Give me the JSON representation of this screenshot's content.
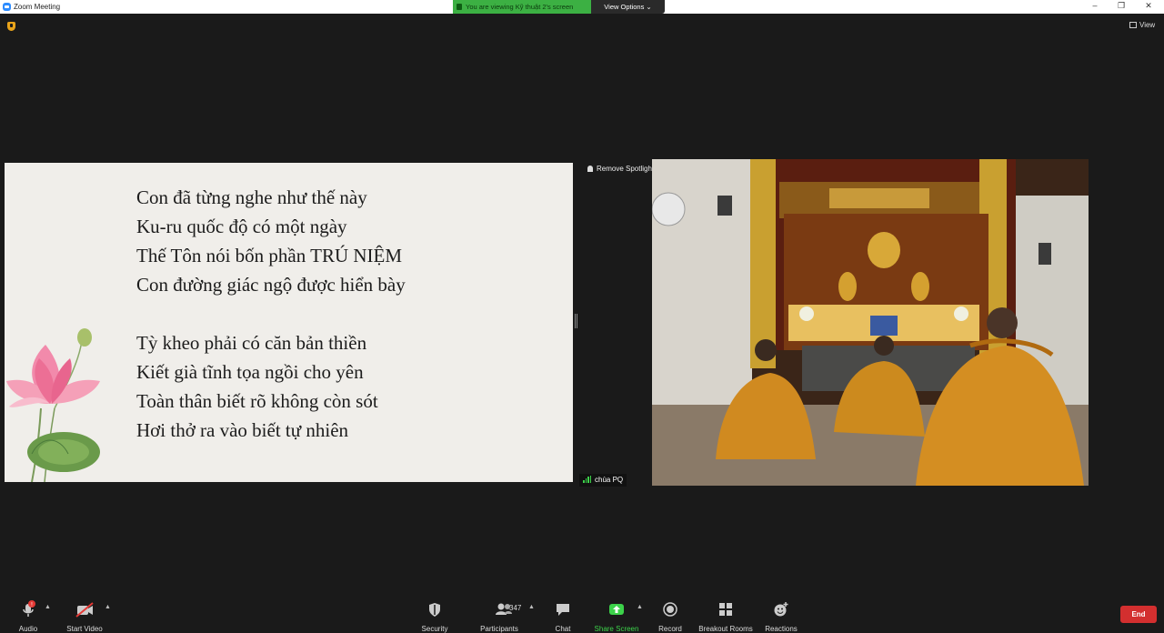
{
  "window": {
    "title": "Zoom Meeting",
    "controls": {
      "minimize": "–",
      "restore": "❐",
      "close": "✕"
    }
  },
  "banner": {
    "viewing_text": "You are viewing Kỹ thuật 2's screen",
    "view_options_label": "View Options ⌄",
    "view_button_label": "View",
    "colors": {
      "banner_green": "#3cb043"
    }
  },
  "slide": {
    "stanza1": [
      "Con đã từng nghe như thế này",
      "Ku-ru quốc độ có một ngày",
      "Thế Tôn nói bốn phần TRÚ NIỆM",
      "Con đường giác ngộ được hiển bày"
    ],
    "stanza2": [
      "Tỳ kheo phải có căn bản thiền",
      "Kiết già tĩnh tọa ngồi cho yên",
      "Toàn thân biết rõ không còn sót",
      "Hơi thở ra vào biết tự nhiên"
    ]
  },
  "video": {
    "remove_spotlight_label": "Remove Spotlight",
    "participant_name": "chùa PQ"
  },
  "toolbar": {
    "audio": {
      "label": "Audio",
      "badge": "!"
    },
    "video": {
      "label": "Start Video"
    },
    "security": {
      "label": "Security"
    },
    "participants": {
      "label": "Participants",
      "count": "347"
    },
    "chat": {
      "label": "Chat"
    },
    "share": {
      "label": "Share Screen"
    },
    "record": {
      "label": "Record"
    },
    "breakout": {
      "label": "Breakout Rooms"
    },
    "reactions": {
      "label": "Reactions"
    },
    "end": {
      "label": "End"
    },
    "colors": {
      "share_green": "#3cd24a",
      "end_red": "#d32f2f"
    }
  }
}
